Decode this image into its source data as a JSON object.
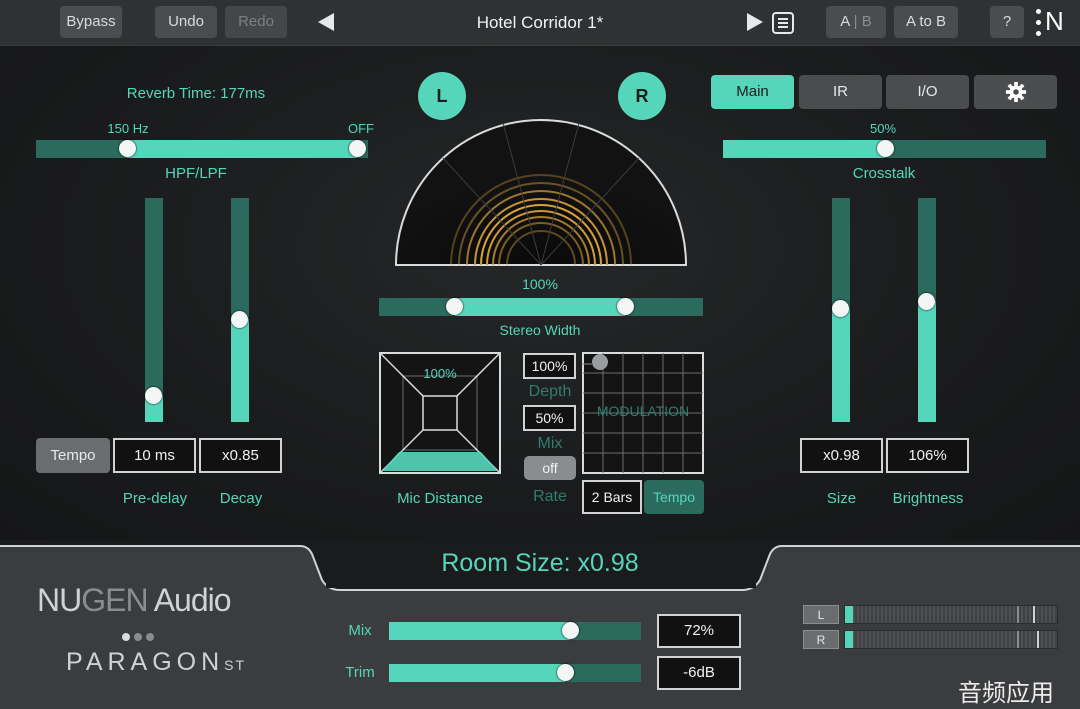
{
  "topbar": {
    "bypass": "Bypass",
    "undo": "Undo",
    "redo": "Redo",
    "preset_name": "Hotel Corridor 1*",
    "ab_a": "A",
    "ab_b": "B",
    "a_to_b": "A to B",
    "help": "?",
    "logo": "N"
  },
  "left": {
    "reverb_time": "Reverb Time: 177ms",
    "hpf_value": "150 Hz",
    "lpf_value": "OFF",
    "hpf_lpf_label": "HPF/LPF",
    "tempo_button": "Tempo",
    "predelay_value": "10 ms",
    "decay_value": "x0.85",
    "predelay_label": "Pre-delay",
    "decay_label": "Decay",
    "predelay_level": 0.12,
    "decay_level": 0.46
  },
  "center": {
    "left_channel": "L",
    "right_channel": "R",
    "stereo_width_value": "100%",
    "stereo_width_label": "Stereo Width",
    "mic_distance_value": "100%",
    "mic_distance_label": "Mic Distance",
    "depth_value": "100%",
    "depth_label": "Depth",
    "mix_value": "50%",
    "mix_label": "Mix",
    "rate_toggle": "off",
    "rate_label": "Rate",
    "modulation_title": "MODULATION",
    "bars_value": "2 Bars",
    "tempo_button": "Tempo"
  },
  "right": {
    "tabs": [
      {
        "label": "Main",
        "active": true
      },
      {
        "label": "IR",
        "active": false
      },
      {
        "label": "I/O",
        "active": false
      },
      {
        "label": "gear-icon",
        "active": false
      }
    ],
    "crosstalk_value": "50%",
    "crosstalk_label": "Crosstalk",
    "crosstalk_level": 0.5,
    "size_value": "x0.98",
    "brightness_value": "106%",
    "size_label": "Size",
    "brightness_label": "Brightness",
    "size_level": 0.51,
    "brightness_level": 0.54
  },
  "room_size": "Room Size: x0.98",
  "bottom": {
    "brand_nu": "NU",
    "brand_gen": "GEN",
    "brand_audio": " Audio",
    "product": "PARAGON",
    "product_suffix": "ST",
    "mix_label": "Mix",
    "mix_value": "72%",
    "mix_level": 0.72,
    "trim_label": "Trim",
    "trim_value": "-6dB",
    "trim_level": 0.7,
    "meter_l": "L",
    "meter_r": "R"
  },
  "watermark": "音频应用",
  "colors": {
    "accent": "#55d6bb",
    "track": "#2b6b5e",
    "panel": "#1a1b1c"
  }
}
